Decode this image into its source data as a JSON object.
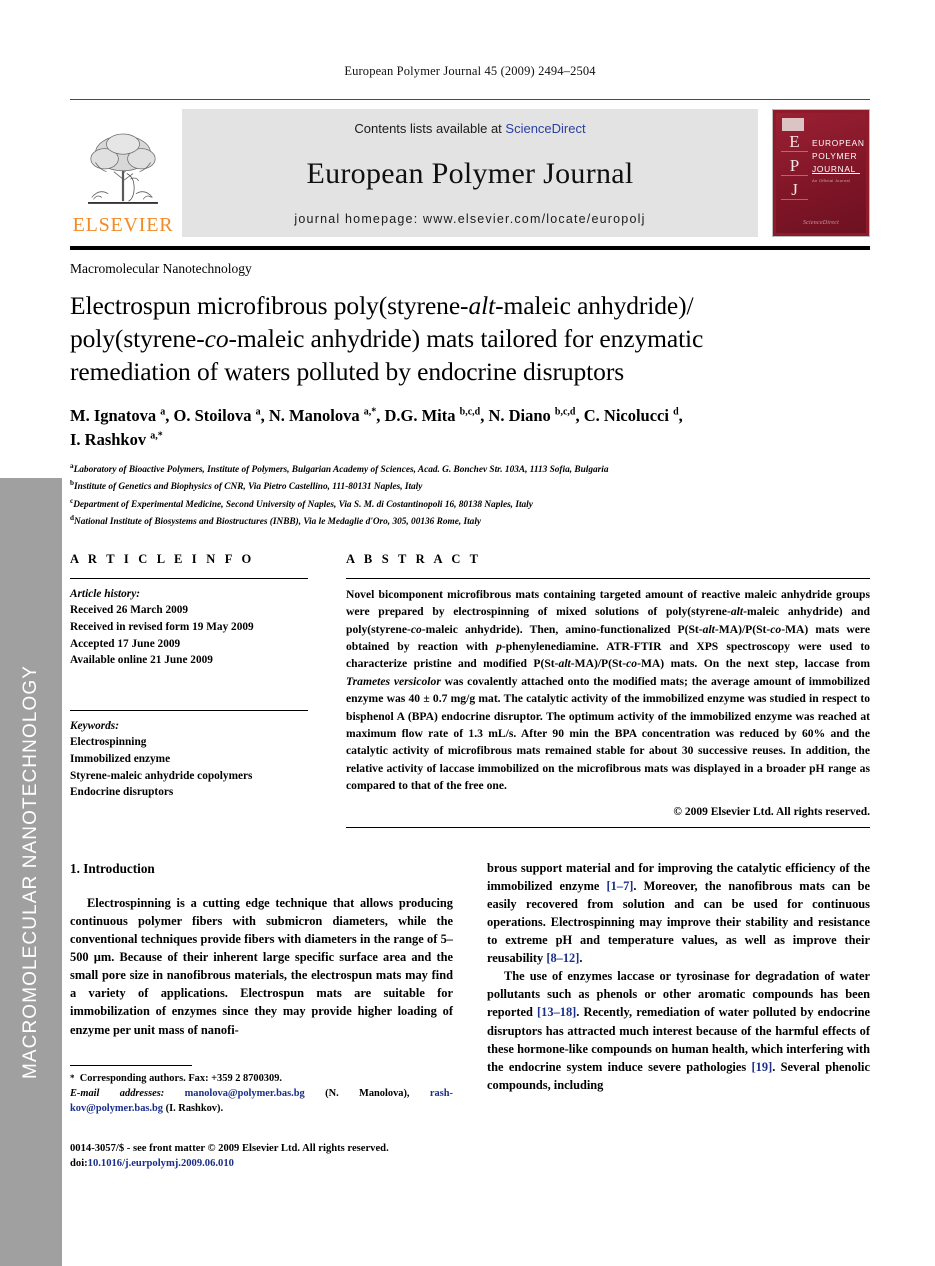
{
  "sidebar": {
    "vertical_label": "MACROMOLECULAR NANOTECHNOLOGY",
    "band_color": "#a0a0a0"
  },
  "running_head": "European Polymer Journal 45 (2009) 2494–2504",
  "masthead": {
    "publisher_name": "ELSEVIER",
    "publisher_color": "#F28A28",
    "contents_prefix": "Contents lists available at ",
    "contents_link": "ScienceDirect",
    "contents_link_color": "#2b3fa0",
    "journal_title": "European Polymer Journal",
    "homepage": "journal homepage: www.elsevier.com/locate/europolj",
    "cover": {
      "letters": [
        "E",
        "P",
        "J"
      ],
      "title_lines": [
        "EUROPEAN",
        "POLYMER",
        "JOURNAL"
      ],
      "subtitle": "An Official Journal",
      "footer": "ScienceDirect",
      "background_color": "#8e1a2a"
    }
  },
  "section_label": "Macromolecular Nanotechnology",
  "article": {
    "title_line1_a": "Electrospun microfibrous poly(styrene-",
    "title_line1_i": "alt",
    "title_line1_b": "-maleic anhydride)/",
    "title_line2_a": "poly(styrene-",
    "title_line2_i": "co",
    "title_line2_b": "-maleic anhydride) mats tailored for enzymatic",
    "title_line3": "remediation of waters polluted by endocrine disruptors",
    "authors_line1": "M. Ignatova <sup>a</sup>, O. Stoilova <sup>a</sup>, N. Manolova <sup>a,*</sup>, D.G. Mita <sup>b,c,d</sup>, N. Diano <sup>b,c,d</sup>, C. Nicolucci <sup>d</sup>,",
    "authors_line2": "I. Rashkov <sup>a,*</sup>",
    "affiliations": [
      {
        "mark": "a",
        "text": "Laboratory of Bioactive Polymers, Institute of Polymers, Bulgarian Academy of Sciences, Acad. G. Bonchev Str. 103A, 1113 Sofia, Bulgaria"
      },
      {
        "mark": "b",
        "text": "Institute of Genetics and Biophysics of CNR, Via Pietro Castellino, 111-80131 Naples, Italy"
      },
      {
        "mark": "c",
        "text": "Department of Experimental Medicine, Second University of Naples, Via S. M. di Costantinopoli 16, 80138 Naples, Italy"
      },
      {
        "mark": "d",
        "text": "National Institute of Biosystems and Biostructures (INBB), Via le Medaglie d'Oro, 305, 00136 Rome, Italy"
      }
    ]
  },
  "article_info": {
    "heading": "A R T I C L E   I N F O",
    "history_label": "Article history:",
    "history": [
      "Received 26 March 2009",
      "Received in revised form 19 May 2009",
      "Accepted 17 June 2009",
      "Available online 21 June 2009"
    ],
    "keywords_label": "Keywords:",
    "keywords": [
      "Electrospinning",
      "Immobilized enzyme",
      "Styrene-maleic anhydride copolymers",
      "Endocrine disruptors"
    ]
  },
  "abstract": {
    "heading": "A B S T R A C T",
    "body_html": "Novel bicomponent microfibrous mats containing targeted amount of reactive maleic anhydride groups were prepared by electrospinning of mixed solutions of poly(styrene-<i>alt</i>-maleic anhydride) and poly(styrene-<i>co</i>-maleic anhydride). Then, amino-functionalized P(St-<i>alt</i>-MA)/P(St-<i>co</i>-MA) mats were obtained by reaction with <i>p</i>-phenylenediamine. ATR-FTIR and XPS spectroscopy were used to characterize pristine and modified P(St-<i>alt</i>-MA)/P(St-<i>co</i>-MA) mats. On the next step, laccase from <i>Trametes versicolor</i> was covalently attached onto the modified mats; the average amount of immobilized enzyme was 40 ± 0.7 mg/g mat. The catalytic activity of the immobilized enzyme was studied in respect to bisphenol A (BPA) endocrine disruptor. The optimum activity of the immobilized enzyme was reached at maximum flow rate of 1.3 mL/s. After 90 min the BPA concentration was reduced by 60% and the catalytic activity of microfibrous mats remained stable for about 30 successive reuses. In addition, the relative activity of laccase immobilized on the microfibrous mats was displayed in a broader pH range as compared to that of the free one.",
    "copyright": "© 2009 Elsevier Ltd. All rights reserved."
  },
  "introduction": {
    "heading": "1. Introduction",
    "left_paragraph": "Electrospinning is a cutting edge technique that allows producing continuous polymer fibers with submicron diameters, while the conventional techniques provide fibers with diameters in the range of 5–500 µm. Because of their inherent large specific surface area and the small pore size in nanofibrous materials, the electrospun mats may find a variety of applications. Electrospun mats are suitable for immobilization of enzymes since they may provide higher loading of enzyme per unit mass of nanofi-",
    "right_paragraph_1_html": "brous support material and for improving the catalytic efficiency of the immobilized enzyme <span class=\"ref\">[1–7]</span>. Moreover, the nanofibrous mats can be easily recovered from solution and can be used for continuous operations. Electrospinning may improve their stability and resistance to extreme pH and temperature values, as well as improve their reusability <span class=\"ref\">[8–12]</span>.",
    "right_paragraph_2_html": "The use of enzymes laccase or tyrosinase for degradation of water pollutants such as phenols or other aromatic compounds has been reported <span class=\"ref\">[13–18]</span>. Recently, remediation of water polluted by endocrine disruptors has attracted much interest because of the harmful effects of these hormone-like compounds on human health, which interfering with the endocrine system induce severe pathologies <span class=\"ref\">[19]</span>. Several phenolic compounds, including"
  },
  "footer": {
    "corresponding_html": "<span class=\"star\">*</span>&nbsp; Corresponding authors. Fax: +359 2 8700309.",
    "email_html": "<i>E-mail addresses:</i> <span class=\"mail\">manolova@polymer.bas.bg</span> (N. Manolova), <span class=\"mail\">rash-kov@polymer.bas.bg</span> (I. Rashkov).",
    "issn_line_html": "0014-3057/$ - see front matter © 2009 Elsevier Ltd. All rights reserved.",
    "doi_html": "doi:<span class=\"doi-link\">10.1016/j.eurpolymj.2009.06.010</span>"
  }
}
